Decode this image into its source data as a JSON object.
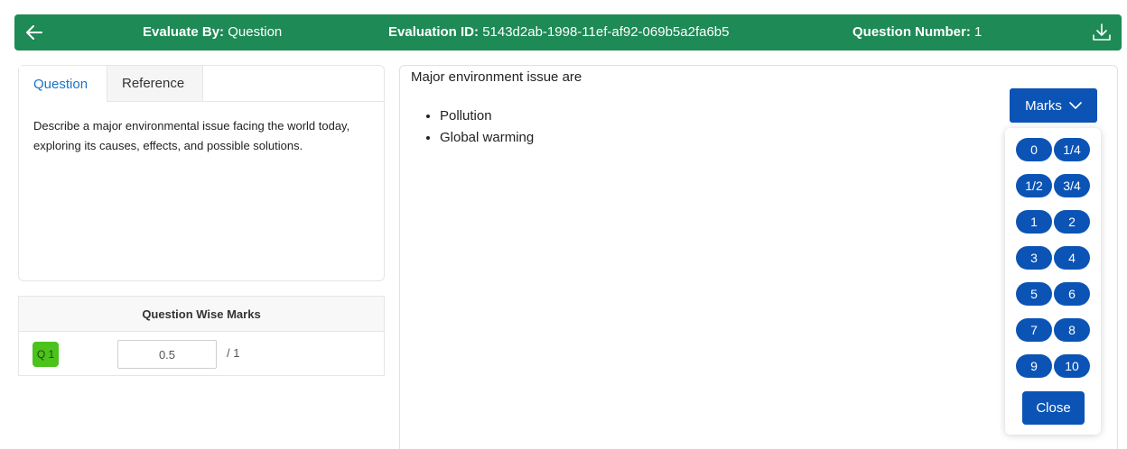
{
  "header": {
    "evaluate_by_label": "Evaluate By:",
    "evaluate_by_value": "Question",
    "evaluation_id_label": "Evaluation ID:",
    "evaluation_id_value": "5143d2ab-1998-11ef-af92-069b5a2fa6b5",
    "question_number_label": "Question Number:",
    "question_number_value": "1",
    "back_icon": "arrow-left-icon",
    "download_icon": "download-icon"
  },
  "question_panel": {
    "tabs": [
      {
        "label": "Question",
        "active": true
      },
      {
        "label": "Reference",
        "active": false
      }
    ],
    "question_text": "Describe a major environmental issue facing the world today, exploring its causes, effects, and possible solutions."
  },
  "marks_table": {
    "title": "Question Wise Marks",
    "rows": [
      {
        "question": "Q 1",
        "mark_value": "0.5",
        "out_of": "/ 1"
      }
    ]
  },
  "answer": {
    "lead": "Major environment issue are",
    "items": [
      "Pollution",
      "Global warming"
    ]
  },
  "marks_dropdown": {
    "button_label": "Marks",
    "options": [
      "0",
      "1/4",
      "1/2",
      "3/4",
      "1",
      "2",
      "3",
      "4",
      "5",
      "6",
      "7",
      "8",
      "9",
      "10"
    ],
    "close_label": "Close"
  },
  "colors": {
    "header_bg": "#1e8a55",
    "accent_blue": "#0b54b5",
    "tab_active": "#1a73c8",
    "badge_green": "#4cc21c"
  }
}
